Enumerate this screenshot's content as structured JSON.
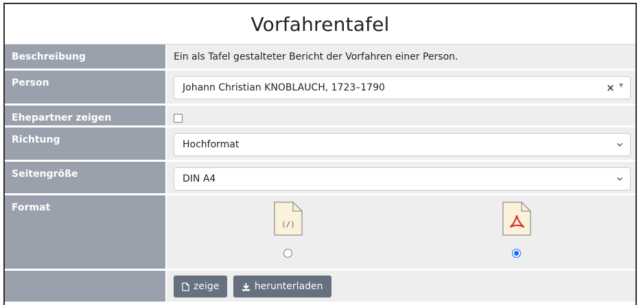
{
  "title": "Vorfahrentafel",
  "rows": {
    "description": {
      "label": "Beschreibung",
      "text": "Ein als Tafel gestalteter Bericht der Vorfahren einer Person."
    },
    "person": {
      "label": "Person",
      "value": "Johann Christian KNOBLAUCH, 1723–1790",
      "clear_symbol": "×"
    },
    "spouse": {
      "label": "Ehepartner zeigen",
      "checked": false
    },
    "direction": {
      "label": "Richtung",
      "selected": "Hochformat"
    },
    "page_size": {
      "label": "Seitengröße",
      "selected": "DIN A4"
    },
    "format": {
      "label": "Format",
      "options": [
        {
          "icon": "html-file-icon",
          "checked": false
        },
        {
          "icon": "pdf-file-icon",
          "checked": true
        }
      ]
    },
    "actions": {
      "label": "",
      "show_label": "zeige",
      "download_label": "herunterladen"
    }
  },
  "colors": {
    "label_bg": "#9aa1ad",
    "value_bg": "#eeeeee",
    "button_bg": "#66707f",
    "radio_accent": "#0d6efd",
    "pdf_red": "#d9342b",
    "file_icon_fill": "#fbf2dc"
  }
}
